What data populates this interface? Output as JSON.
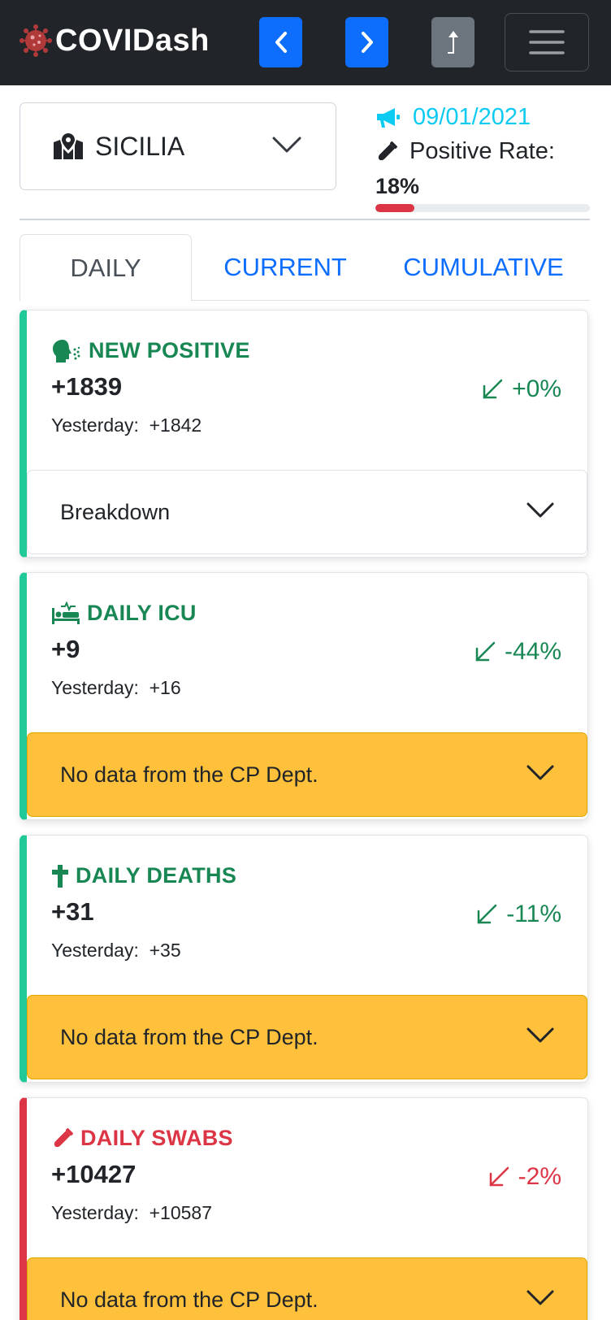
{
  "app": {
    "title": "COVIDash"
  },
  "region": {
    "selected": "SICILIA"
  },
  "info": {
    "date": "09/01/2021",
    "positive_rate_label": "Positive Rate:",
    "positive_rate_value": "18%",
    "positive_rate_fraction": 0.18
  },
  "tabs": [
    {
      "label": "DAILY",
      "active": true
    },
    {
      "label": "CURRENT",
      "active": false
    },
    {
      "label": "CUMULATIVE",
      "active": false
    }
  ],
  "cards": [
    {
      "title": "NEW POSITIVE",
      "icon": "virus-spread-icon",
      "value": "+1839",
      "yesterday_label": "Yesterday:",
      "yesterday_value": "+1842",
      "trend": "+0%",
      "accordion": "Breakdown",
      "status": "good"
    },
    {
      "title": "DAILY ICU",
      "icon": "procedures-icon",
      "value": "+9",
      "yesterday_label": "Yesterday:",
      "yesterday_value": "+16",
      "trend": "-44%",
      "accordion": "No data from the CP Dept.",
      "status": "good"
    },
    {
      "title": "DAILY DEATHS",
      "icon": "cross-icon",
      "value": "+31",
      "yesterday_label": "Yesterday:",
      "yesterday_value": "+35",
      "trend": "-11%",
      "accordion": "No data from the CP Dept.",
      "status": "good"
    },
    {
      "title": "DAILY SWABS",
      "icon": "vial-icon",
      "value": "+10427",
      "yesterday_label": "Yesterday:",
      "yesterday_value": "+10587",
      "trend": "-2%",
      "accordion": "No data from the CP Dept.",
      "status": "bad"
    }
  ],
  "colors": {
    "navbar": "#212529",
    "primary": "#0d6efd",
    "info": "#0dcaf0",
    "success": "#198754",
    "danger": "#dc3545",
    "warning": "#ffc13b",
    "teal": "#20c997"
  }
}
